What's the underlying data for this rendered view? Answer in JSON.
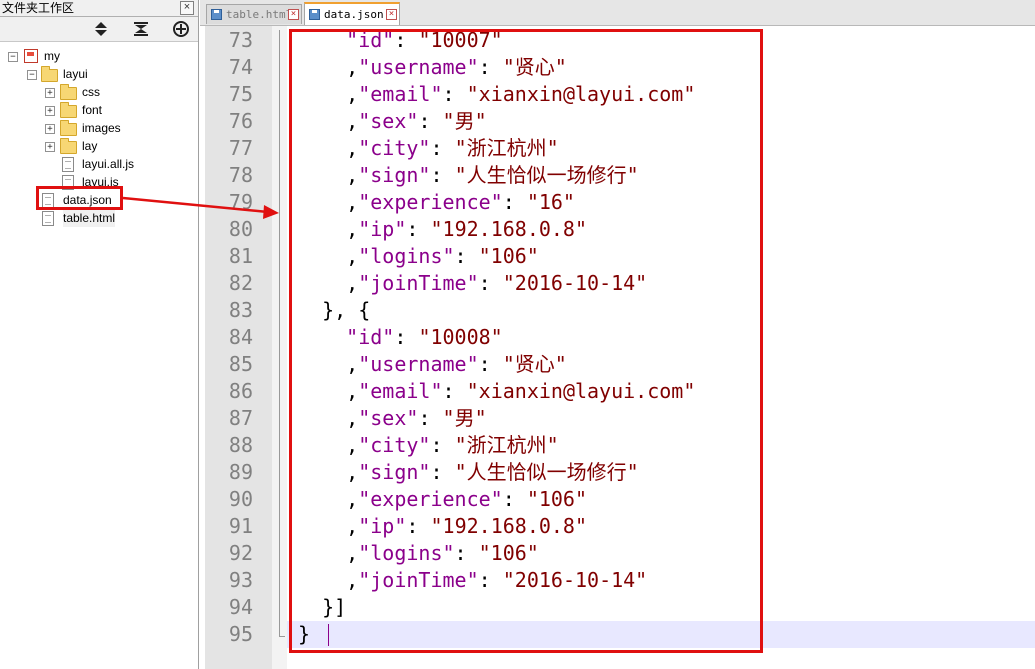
{
  "panel": {
    "title": "文件夹工作区",
    "close_glyph": "×",
    "toolbar": [
      "collapse-expand-icon",
      "sync-icon",
      "add-folder-icon"
    ]
  },
  "tree": {
    "root": "my",
    "layui": "layui",
    "css": "css",
    "font": "font",
    "images": "images",
    "lay": "lay",
    "layui_all": "layui.all.js",
    "layui_js": "layui.js",
    "data_json": "data.json",
    "table_html": "table.html"
  },
  "tabs": [
    {
      "label": "table.html",
      "active": false
    },
    {
      "label": "data.json",
      "active": true
    }
  ],
  "editor": {
    "line_numbers": [
      "73",
      "74",
      "75",
      "76",
      "77",
      "78",
      "79",
      "80",
      "81",
      "82",
      "83",
      "84",
      "85",
      "86",
      "87",
      "88",
      "89",
      "90",
      "91",
      "92",
      "93",
      "94",
      "95"
    ],
    "lines": [
      {
        "indent": "    ",
        "lead": "",
        "key": "\"id\"",
        "sep": ": ",
        "val": "\"10007\""
      },
      {
        "indent": "    ",
        "lead": ",",
        "key": "\"username\"",
        "sep": ": ",
        "val": "\"贤心\""
      },
      {
        "indent": "    ",
        "lead": ",",
        "key": "\"email\"",
        "sep": ": ",
        "val": "\"xianxin@layui.com\""
      },
      {
        "indent": "    ",
        "lead": ",",
        "key": "\"sex\"",
        "sep": ": ",
        "val": "\"男\""
      },
      {
        "indent": "    ",
        "lead": ",",
        "key": "\"city\"",
        "sep": ": ",
        "val": "\"浙江杭州\""
      },
      {
        "indent": "    ",
        "lead": ",",
        "key": "\"sign\"",
        "sep": ": ",
        "val": "\"人生恰似一场修行\""
      },
      {
        "indent": "    ",
        "lead": ",",
        "key": "\"experience\"",
        "sep": ": ",
        "val": "\"16\""
      },
      {
        "indent": "    ",
        "lead": ",",
        "key": "\"ip\"",
        "sep": ": ",
        "val": "\"192.168.0.8\""
      },
      {
        "indent": "    ",
        "lead": ",",
        "key": "\"logins\"",
        "sep": ": ",
        "val": "\"106\""
      },
      {
        "indent": "    ",
        "lead": ",",
        "key": "\"joinTime\"",
        "sep": ": ",
        "val": "\"2016-10-14\""
      },
      {
        "indent": "  ",
        "lead": "}, {",
        "key": "",
        "sep": "",
        "val": ""
      },
      {
        "indent": "    ",
        "lead": "",
        "key": "\"id\"",
        "sep": ": ",
        "val": "\"10008\""
      },
      {
        "indent": "    ",
        "lead": ",",
        "key": "\"username\"",
        "sep": ": ",
        "val": "\"贤心\""
      },
      {
        "indent": "    ",
        "lead": ",",
        "key": "\"email\"",
        "sep": ": ",
        "val": "\"xianxin@layui.com\""
      },
      {
        "indent": "    ",
        "lead": ",",
        "key": "\"sex\"",
        "sep": ": ",
        "val": "\"男\""
      },
      {
        "indent": "    ",
        "lead": ",",
        "key": "\"city\"",
        "sep": ": ",
        "val": "\"浙江杭州\""
      },
      {
        "indent": "    ",
        "lead": ",",
        "key": "\"sign\"",
        "sep": ": ",
        "val": "\"人生恰似一场修行\""
      },
      {
        "indent": "    ",
        "lead": ",",
        "key": "\"experience\"",
        "sep": ": ",
        "val": "\"106\""
      },
      {
        "indent": "    ",
        "lead": ",",
        "key": "\"ip\"",
        "sep": ": ",
        "val": "\"192.168.0.8\""
      },
      {
        "indent": "    ",
        "lead": ",",
        "key": "\"logins\"",
        "sep": ": ",
        "val": "\"106\""
      },
      {
        "indent": "    ",
        "lead": ",",
        "key": "\"joinTime\"",
        "sep": ": ",
        "val": "\"2016-10-14\""
      },
      {
        "indent": "  ",
        "lead": "}]",
        "key": "",
        "sep": "",
        "val": ""
      },
      {
        "indent": "",
        "lead": "}",
        "key": "",
        "sep": "",
        "val": ""
      }
    ]
  },
  "colors": {
    "annotation_red": "#e01010",
    "json_key": "#8b008b",
    "json_string": "#800000",
    "current_line": "#e8e8ff"
  }
}
